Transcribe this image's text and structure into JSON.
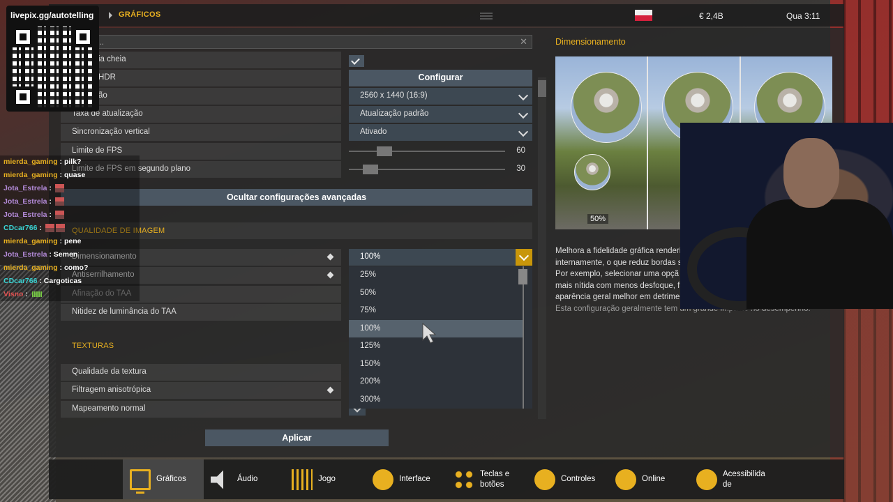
{
  "stream_overlay": {
    "qr_link": "livepix.gg/autotelling",
    "chat": [
      {
        "user": "mierda_gaming",
        "color": "#e8b020",
        "message": "pilk?"
      },
      {
        "user": "mierda_gaming",
        "color": "#e8b020",
        "message": "quase"
      },
      {
        "user": "Jota_Estrela",
        "color": "#b38ad8",
        "message": ""
      },
      {
        "user": "Jota_Estrela",
        "color": "#b38ad8",
        "message": ""
      },
      {
        "user": "Jota_Estrela",
        "color": "#b38ad8",
        "message": ""
      },
      {
        "user": "CDcar766",
        "color": "#3ad4d4",
        "message": ""
      },
      {
        "user": "mierda_gaming",
        "color": "#e8b020",
        "message": "pene"
      },
      {
        "user": "Jota_Estrela",
        "color": "#b38ad8",
        "message": "Semen"
      },
      {
        "user": "mierda_gaming",
        "color": "#e8b020",
        "message": "como?"
      },
      {
        "user": "CDcar766",
        "color": "#3ad4d4",
        "message": "Cargoticas"
      },
      {
        "user": "Visno",
        "color": "#e05050",
        "message": ""
      }
    ]
  },
  "topbar": {
    "breadcrumb": "GRÁFICOS",
    "money": "€ 2,4B",
    "clock": "Qua 3:11"
  },
  "search": {
    "value": "..."
  },
  "settings": {
    "fullscreen_label": "ia cheia",
    "hdr_label": "HDR",
    "hdr_button": "Configurar",
    "resolution_label": "ão",
    "resolution_value": "2560 x 1440 (16:9)",
    "refresh_label": "Taxa de atualização",
    "refresh_value": "Atualização padrão",
    "vsync_label": "Sincronização vertical",
    "vsync_value": "Ativado",
    "fps_label": "Limite de FPS",
    "fps_value": "60",
    "fps_level": 0.2,
    "bg_fps_label": "Limite de FPS em segundo plano",
    "bg_fps_value": "30",
    "bg_fps_level": 0.1,
    "toggle_advanced": "Ocultar configurações avançadas",
    "image_quality_section": "QUALIDADE DE IMAGEM",
    "scaling_label": "Dimensionamento",
    "antialias_label": "Antiserrilhamento",
    "taa_sharp_label": "Afinação do TAA",
    "taa_luma_label": "Nitidez de luminância do TAA",
    "textures_section": "TEXTURAS",
    "texture_quality_label": "Qualidade da textura",
    "aniso_label": "Filtragem anisotrópica",
    "normal_map_label": "Mapeamento normal"
  },
  "dropdown": {
    "selected": "100%",
    "options": [
      "25%",
      "50%",
      "75%",
      "100%",
      "125%",
      "150%",
      "200%",
      "300%"
    ],
    "highlighted_index": 3
  },
  "apply_button": "Aplicar",
  "preview": {
    "title": "Dimensionamento",
    "badge": "50%",
    "description_lines": [
      "Melhora a fidelidade gráfica renderi",
      "internamente, o que reduz bordas s",
      "Por exemplo, selecionar uma opçã",
      "mais nítida com menos desfoque, fa",
      "aparência geral melhor em detrimen"
    ],
    "note": "Esta configuração geralmente tem um grande impacto no desempenho."
  },
  "nav": {
    "tabs": [
      {
        "label": "Gráficos",
        "icon": "monitor-icon"
      },
      {
        "label": "Áudio",
        "icon": "speaker-icon"
      },
      {
        "label": "Jogo",
        "icon": "sliders-icon"
      },
      {
        "label": "Interface",
        "icon": "cursor-icon"
      },
      {
        "label": "Teclas e botões",
        "icon": "keys-icon"
      },
      {
        "label": "Controles",
        "icon": "steering-wheel-icon"
      },
      {
        "label": "Online",
        "icon": "globe-icon"
      },
      {
        "label": "Acessibilida de",
        "icon": "accessibility-icon"
      }
    ]
  }
}
